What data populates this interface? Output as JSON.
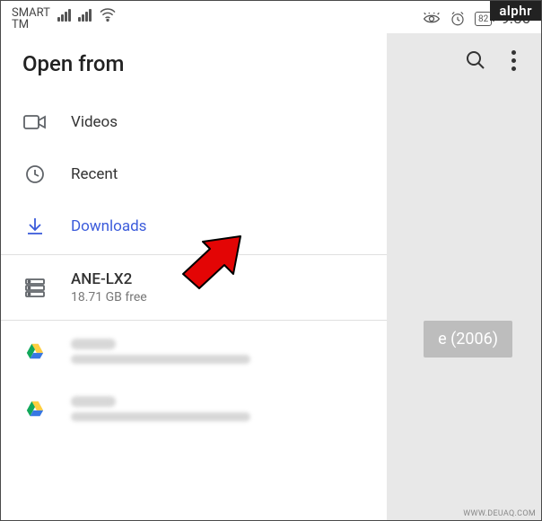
{
  "statusbar": {
    "carrier_line1": "SMART",
    "carrier_line2": "TM",
    "battery_text": "82",
    "clock": "9:56"
  },
  "panel": {
    "title": "Open from",
    "items": {
      "videos": "Videos",
      "recent": "Recent",
      "downloads": "Downloads",
      "storage_name": "ANE-LX2",
      "storage_free": "18.71 GB free"
    }
  },
  "backdrop": {
    "chip_text": "e (2006)"
  },
  "watermark": {
    "tag": "alphr",
    "site": "WWW.DEUAQ.COM"
  }
}
